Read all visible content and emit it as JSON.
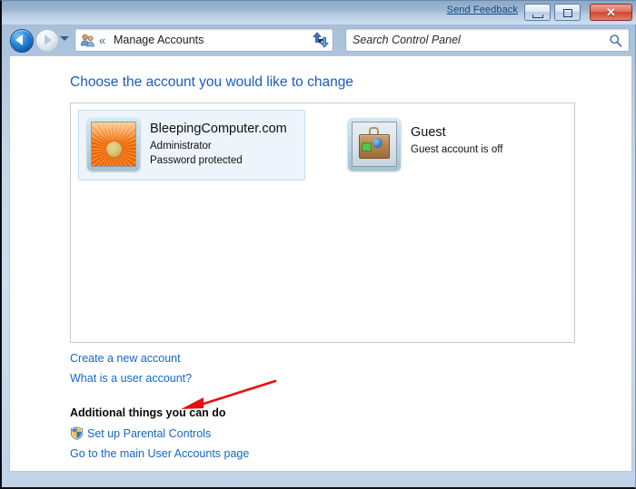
{
  "window": {
    "titlebar": {
      "send_feedback_label": "Send Feedback",
      "minimize_label": "",
      "maximize_label": "",
      "close_label": "✕"
    },
    "navbar": {
      "breadcrumb_chevron": "«",
      "breadcrumb_label": "Manage Accounts",
      "address_icon": "user-accounts-icon",
      "refresh_icon": "refresh-icon"
    },
    "search": {
      "placeholder": "Search Control Panel",
      "value": "Search Control Panel",
      "icon": "search-icon"
    }
  },
  "main": {
    "heading": "Choose the account you would like to change",
    "accounts": [
      {
        "name": "BleepingComputer.com",
        "line1": "Administrator",
        "line2": "Password protected",
        "picture": "sunflower-picture",
        "selected": true
      },
      {
        "name": "Guest",
        "line1": "Guest account is off",
        "line2": "",
        "picture": "suitcase-picture",
        "selected": false
      }
    ],
    "links": {
      "create_account": "Create a new account",
      "what_is_account": "What is a user account?"
    },
    "additional": {
      "heading": "Additional things you can do",
      "parental_controls": "Set up Parental Controls",
      "main_user_accounts": "Go to the main User Accounts page"
    }
  },
  "annotation": {
    "arrow_color": "#e8100f",
    "points_to": "Create a new account"
  },
  "colors": {
    "heading_blue": "#1c5dbd",
    "link_blue": "#1667c4",
    "selected_tile_bg": "#eef4fb",
    "selected_tile_border": "#c4ddf2",
    "panel_border": "#c8c8c8",
    "frame_blue": "#c3d5e8",
    "close_button_red": "#cc4630"
  }
}
